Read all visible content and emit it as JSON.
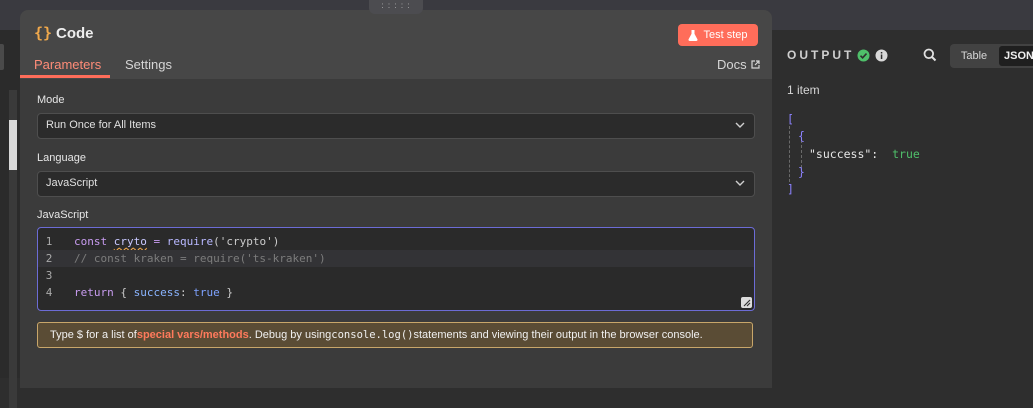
{
  "node": {
    "title": "Code",
    "title_icon": "{}",
    "test_step_label": "Test step",
    "tabs": [
      "Parameters",
      "Settings"
    ],
    "docs_label": "Docs"
  },
  "fields": {
    "mode": {
      "label": "Mode",
      "value": "Run Once for All Items"
    },
    "language": {
      "label": "Language",
      "value": "JavaScript"
    },
    "code": {
      "label": "JavaScript",
      "lines": [
        {
          "n": "1",
          "kw": "const ",
          "var": "cryto",
          "rest1": " = ",
          "fn": "require",
          "rest2": "('crypto')"
        },
        {
          "n": "2",
          "text": "// const kraken = require('ts-kraken')"
        },
        {
          "n": "3",
          "text": ""
        },
        {
          "n": "4",
          "kw": "return",
          "rest1": " { ",
          "prop": "success",
          "rest2": ": ",
          "bool": "true",
          "rest3": " }"
        }
      ]
    }
  },
  "hint": {
    "prefix": "Type $ for a list of ",
    "link": "special vars/methods",
    "middle": ". Debug by using ",
    "code": "console.log()",
    "suffix": " statements and viewing their output in the browser console."
  },
  "output": {
    "label": "OUTPUT",
    "views": [
      "Table",
      "JSON"
    ],
    "item_count": "1 item",
    "json_key": "\"success\":",
    "json_value": "true"
  },
  "colors": {
    "accent": "#ff6d5a",
    "success": "#4fbf6a",
    "json_bracket": "#8c82ff"
  }
}
